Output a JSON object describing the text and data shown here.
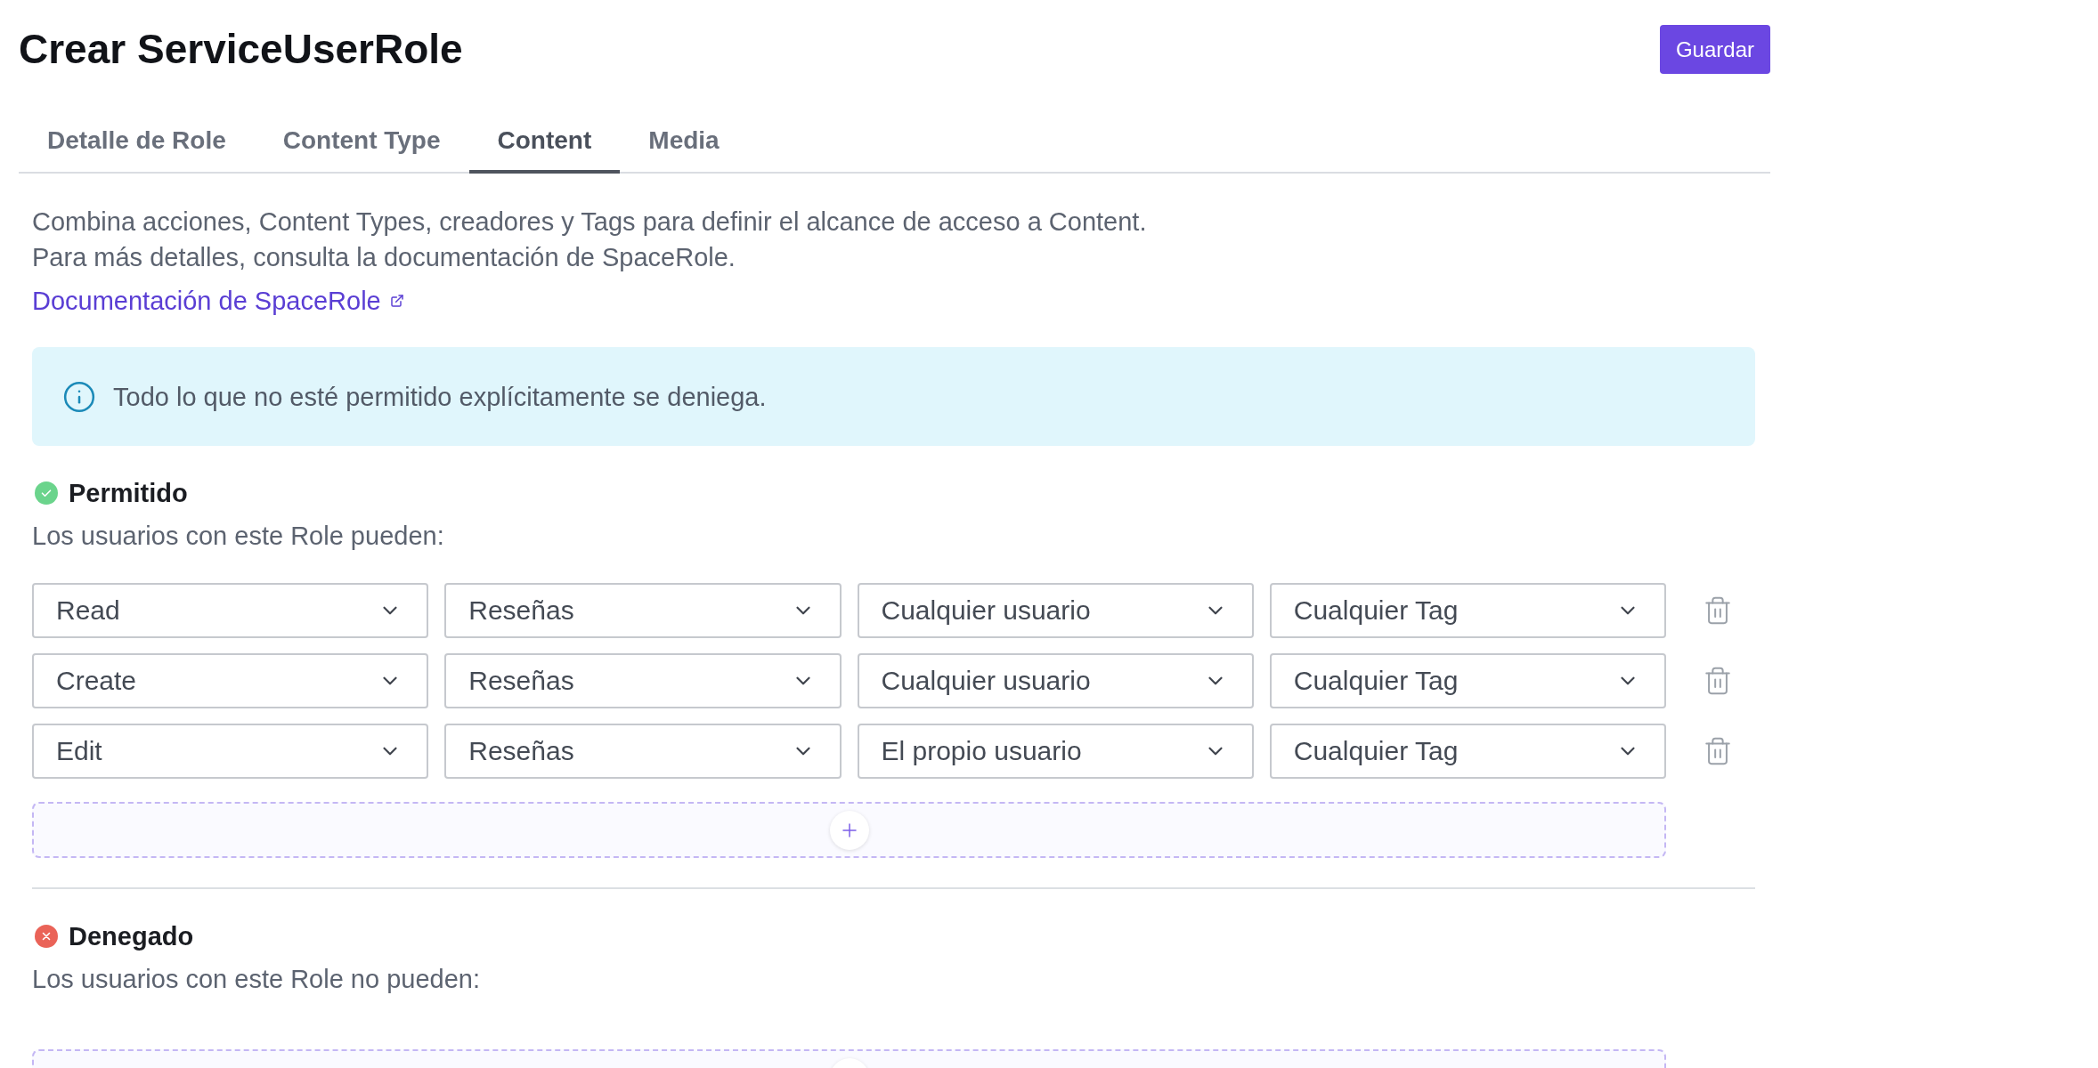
{
  "header": {
    "title": "Crear ServiceUserRole",
    "save_button": "Guardar"
  },
  "tabs": [
    {
      "label": "Detalle de Role",
      "selected": false
    },
    {
      "label": "Content Type",
      "selected": false
    },
    {
      "label": "Content",
      "selected": true
    },
    {
      "label": "Media",
      "selected": false
    }
  ],
  "description": {
    "lines": [
      "Combina acciones, Content Types, creadores y Tags para definir el alcance de acceso a Content.",
      "Para más detalles, consulta la documentación de SpaceRole."
    ],
    "link": "Documentación de SpaceRole"
  },
  "info_banner": {
    "text": "Todo lo que no esté permitido explícitamente se deniega."
  },
  "sections": [
    {
      "kind": "allowed",
      "title": "Permitido",
      "subtitle": "Los usuarios con este Role pueden:",
      "rules": [
        {
          "action": "Read",
          "content_type": "Reseñas",
          "creator": "Cualquier usuario",
          "tag": "Cualquier Tag"
        },
        {
          "action": "Create",
          "content_type": "Reseñas",
          "creator": "Cualquier usuario",
          "tag": "Cualquier Tag"
        },
        {
          "action": "Edit",
          "content_type": "Reseñas",
          "creator": "El propio usuario",
          "tag": "Cualquier Tag"
        }
      ]
    },
    {
      "kind": "denied",
      "title": "Denegado",
      "subtitle": "Los usuarios con este Role no pueden:"
    }
  ]
}
